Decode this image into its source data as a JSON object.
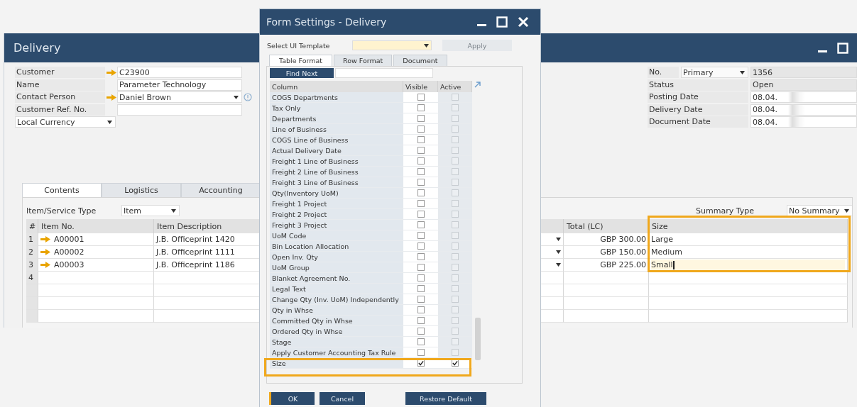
{
  "delivery_window": {
    "title": "Delivery",
    "header_left": [
      {
        "label": "Customer",
        "value": "C23900",
        "link": true,
        "kind": "field"
      },
      {
        "label": "Name",
        "value": "Parameter Technology",
        "link": false,
        "kind": "field"
      },
      {
        "label": "Contact Person",
        "value": "Daniel Brown",
        "link": true,
        "kind": "dropdown"
      },
      {
        "label": "Customer Ref. No.",
        "link": false,
        "kind": "field"
      }
    ],
    "currency_dropdown": {
      "value": "Local Currency"
    },
    "header_right": [
      {
        "label": "No.",
        "series": "Primary",
        "value": "1356",
        "kind": "series"
      },
      {
        "label": "Status",
        "value": "Open",
        "kind": "readonly"
      },
      {
        "label": "Posting Date",
        "value": "08.04.",
        "kind": "date"
      },
      {
        "label": "Delivery Date",
        "value": "08.04.",
        "kind": "date"
      },
      {
        "label": "Document Date",
        "value": "08.04.",
        "kind": "date"
      }
    ],
    "tabs": [
      {
        "label": "Contents",
        "selected": true
      },
      {
        "label": "Logistics",
        "selected": false
      },
      {
        "label": "Accounting",
        "selected": false
      }
    ],
    "item_type": {
      "label": "Item/Service Type",
      "value": "Item"
    },
    "summary_type": {
      "label": "Summary Type",
      "value": "No Summary"
    },
    "table": {
      "size_column_highlighted": true,
      "columns": {
        "column_1": "#",
        "item_no": "Item No.",
        "item_description": "Item Description",
        "total_lc": "Total (LC)",
        "size": "Size"
      },
      "rows": [
        {
          "number": "1",
          "item_no": "A00001",
          "item_description": "J.B. Officeprint 1420",
          "dropdown": true,
          "total_lc": "GBP 300.00",
          "size": "Large",
          "editing": false
        },
        {
          "number": "2",
          "item_no": "A00002",
          "item_description": "J.B. Officeprint 1111",
          "dropdown": true,
          "total_lc": "GBP 150.00",
          "size": "Medium",
          "editing": false
        },
        {
          "number": "3",
          "item_no": "A00003",
          "item_description": "J.B. Officeprint 1186",
          "dropdown": true,
          "total_lc": "GBP 225.00",
          "size": "Small",
          "editing": true
        },
        {
          "number": "4",
          "dropdown": false,
          "editing": false
        }
      ]
    }
  },
  "dialog": {
    "title": "Form Settings - Delivery",
    "template": {
      "label": "Select UI Template"
    },
    "apply_button": {
      "label": "Apply",
      "disabled": true
    },
    "tabs": [
      {
        "label": "Table Format",
        "selected": true
      },
      {
        "label": "Row Format",
        "selected": false
      },
      {
        "label": "Document",
        "selected": false
      }
    ],
    "find_button": {
      "label": "Find Next"
    },
    "grid": {
      "columns": [
        "Column",
        "Visible",
        "Active"
      ],
      "rows": [
        {
          "name": "COGS Departments",
          "visible": false,
          "active": false,
          "highlighted": false
        },
        {
          "name": "Tax Only",
          "visible": false,
          "active": false,
          "highlighted": false
        },
        {
          "name": "Departments",
          "visible": false,
          "active": false,
          "highlighted": false
        },
        {
          "name": "Line of Business",
          "visible": false,
          "active": false,
          "highlighted": false
        },
        {
          "name": "COGS Line of Business",
          "visible": false,
          "active": false,
          "highlighted": false
        },
        {
          "name": "Actual Delivery Date",
          "visible": false,
          "active": false,
          "highlighted": false
        },
        {
          "name": "Freight 1 Line of Business",
          "visible": false,
          "active": false,
          "highlighted": false
        },
        {
          "name": "Freight 2 Line of Business",
          "visible": false,
          "active": false,
          "highlighted": false
        },
        {
          "name": "Freight 3 Line of Business",
          "visible": false,
          "active": false,
          "highlighted": false
        },
        {
          "name": "Qty(Inventory UoM)",
          "visible": false,
          "active": false,
          "highlighted": false
        },
        {
          "name": "Freight 1 Project",
          "visible": false,
          "active": false,
          "highlighted": false
        },
        {
          "name": "Freight 2 Project",
          "visible": false,
          "active": false,
          "highlighted": false
        },
        {
          "name": "Freight 3 Project",
          "visible": false,
          "active": false,
          "highlighted": false
        },
        {
          "name": "UoM Code",
          "visible": false,
          "active": false,
          "highlighted": false
        },
        {
          "name": "Bin Location Allocation",
          "visible": false,
          "active": false,
          "highlighted": false
        },
        {
          "name": "Open Inv. Qty",
          "visible": false,
          "active": false,
          "highlighted": false
        },
        {
          "name": "UoM Group",
          "visible": false,
          "active": false,
          "highlighted": false
        },
        {
          "name": "Blanket Agreement No.",
          "visible": false,
          "active": false,
          "highlighted": false
        },
        {
          "name": "Legal Text",
          "visible": false,
          "active": false,
          "highlighted": false
        },
        {
          "name": "Change Qty (Inv. UoM) Independently",
          "visible": false,
          "active": false,
          "highlighted": false
        },
        {
          "name": "Qty in Whse",
          "visible": false,
          "active": false,
          "highlighted": false
        },
        {
          "name": "Committed Qty in Whse",
          "visible": false,
          "active": false,
          "highlighted": false
        },
        {
          "name": "Ordered Qty in Whse",
          "visible": false,
          "active": false,
          "highlighted": false
        },
        {
          "name": "Stage",
          "visible": false,
          "active": false,
          "highlighted": false
        },
        {
          "name": "Apply Customer Accounting Tax Rule",
          "visible": false,
          "active": false,
          "highlighted": false
        },
        {
          "name": "Size",
          "visible": true,
          "active": true,
          "highlighted": true
        }
      ]
    },
    "buttons": [
      {
        "label": "OK",
        "focused": true
      },
      {
        "label": "Cancel",
        "focused": false
      },
      {
        "label": "Restore Default",
        "focused": false
      }
    ]
  }
}
